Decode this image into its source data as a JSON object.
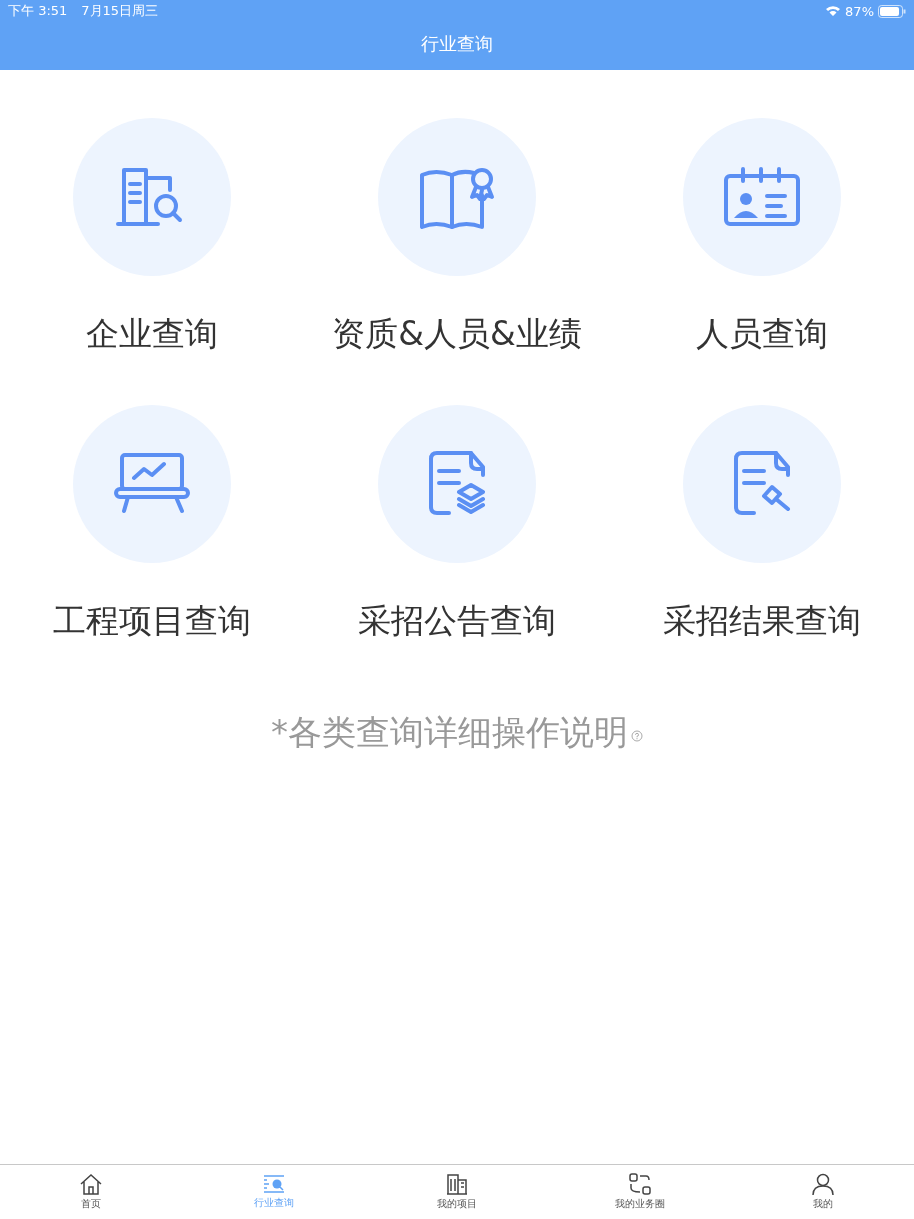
{
  "status_bar": {
    "time": "下午 3:51",
    "date": "7月15日周三",
    "battery": "87%"
  },
  "header": {
    "title": "行业查询"
  },
  "tiles": [
    {
      "label": "企业查询"
    },
    {
      "label": "资质&人员&业绩"
    },
    {
      "label": "人员查询"
    },
    {
      "label": "工程项目查询"
    },
    {
      "label": "采招公告查询"
    },
    {
      "label": "采招结果查询"
    }
  ],
  "note": "*各类查询详细操作说明",
  "tab_bar": [
    {
      "label": "首页",
      "selected": false
    },
    {
      "label": "行业查询",
      "selected": true
    },
    {
      "label": "我的项目",
      "selected": false
    },
    {
      "label": "我的业务圈",
      "selected": false
    },
    {
      "label": "我的",
      "selected": false
    }
  ]
}
